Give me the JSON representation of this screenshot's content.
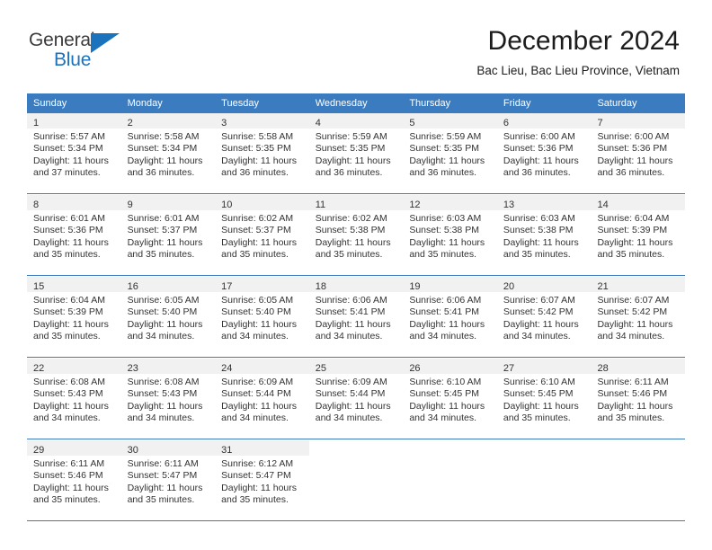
{
  "brand": {
    "name_part1": "General",
    "name_part2": "Blue",
    "accent_color": "#1b72bd"
  },
  "header": {
    "month_title": "December 2024",
    "location": "Bac Lieu, Bac Lieu Province, Vietnam",
    "header_bg_color": "#3b7cc1",
    "daynum_band_color": "#f1f1f1"
  },
  "weekdays": [
    "Sunday",
    "Monday",
    "Tuesday",
    "Wednesday",
    "Thursday",
    "Friday",
    "Saturday"
  ],
  "weeks": [
    [
      {
        "day": "1",
        "lines": [
          "Sunrise: 5:57 AM",
          "Sunset: 5:34 PM",
          "Daylight: 11 hours",
          "and 37 minutes."
        ]
      },
      {
        "day": "2",
        "lines": [
          "Sunrise: 5:58 AM",
          "Sunset: 5:34 PM",
          "Daylight: 11 hours",
          "and 36 minutes."
        ]
      },
      {
        "day": "3",
        "lines": [
          "Sunrise: 5:58 AM",
          "Sunset: 5:35 PM",
          "Daylight: 11 hours",
          "and 36 minutes."
        ]
      },
      {
        "day": "4",
        "lines": [
          "Sunrise: 5:59 AM",
          "Sunset: 5:35 PM",
          "Daylight: 11 hours",
          "and 36 minutes."
        ]
      },
      {
        "day": "5",
        "lines": [
          "Sunrise: 5:59 AM",
          "Sunset: 5:35 PM",
          "Daylight: 11 hours",
          "and 36 minutes."
        ]
      },
      {
        "day": "6",
        "lines": [
          "Sunrise: 6:00 AM",
          "Sunset: 5:36 PM",
          "Daylight: 11 hours",
          "and 36 minutes."
        ]
      },
      {
        "day": "7",
        "lines": [
          "Sunrise: 6:00 AM",
          "Sunset: 5:36 PM",
          "Daylight: 11 hours",
          "and 36 minutes."
        ]
      }
    ],
    [
      {
        "day": "8",
        "lines": [
          "Sunrise: 6:01 AM",
          "Sunset: 5:36 PM",
          "Daylight: 11 hours",
          "and 35 minutes."
        ]
      },
      {
        "day": "9",
        "lines": [
          "Sunrise: 6:01 AM",
          "Sunset: 5:37 PM",
          "Daylight: 11 hours",
          "and 35 minutes."
        ]
      },
      {
        "day": "10",
        "lines": [
          "Sunrise: 6:02 AM",
          "Sunset: 5:37 PM",
          "Daylight: 11 hours",
          "and 35 minutes."
        ]
      },
      {
        "day": "11",
        "lines": [
          "Sunrise: 6:02 AM",
          "Sunset: 5:38 PM",
          "Daylight: 11 hours",
          "and 35 minutes."
        ]
      },
      {
        "day": "12",
        "lines": [
          "Sunrise: 6:03 AM",
          "Sunset: 5:38 PM",
          "Daylight: 11 hours",
          "and 35 minutes."
        ]
      },
      {
        "day": "13",
        "lines": [
          "Sunrise: 6:03 AM",
          "Sunset: 5:38 PM",
          "Daylight: 11 hours",
          "and 35 minutes."
        ]
      },
      {
        "day": "14",
        "lines": [
          "Sunrise: 6:04 AM",
          "Sunset: 5:39 PM",
          "Daylight: 11 hours",
          "and 35 minutes."
        ]
      }
    ],
    [
      {
        "day": "15",
        "lines": [
          "Sunrise: 6:04 AM",
          "Sunset: 5:39 PM",
          "Daylight: 11 hours",
          "and 35 minutes."
        ]
      },
      {
        "day": "16",
        "lines": [
          "Sunrise: 6:05 AM",
          "Sunset: 5:40 PM",
          "Daylight: 11 hours",
          "and 34 minutes."
        ]
      },
      {
        "day": "17",
        "lines": [
          "Sunrise: 6:05 AM",
          "Sunset: 5:40 PM",
          "Daylight: 11 hours",
          "and 34 minutes."
        ]
      },
      {
        "day": "18",
        "lines": [
          "Sunrise: 6:06 AM",
          "Sunset: 5:41 PM",
          "Daylight: 11 hours",
          "and 34 minutes."
        ]
      },
      {
        "day": "19",
        "lines": [
          "Sunrise: 6:06 AM",
          "Sunset: 5:41 PM",
          "Daylight: 11 hours",
          "and 34 minutes."
        ]
      },
      {
        "day": "20",
        "lines": [
          "Sunrise: 6:07 AM",
          "Sunset: 5:42 PM",
          "Daylight: 11 hours",
          "and 34 minutes."
        ]
      },
      {
        "day": "21",
        "lines": [
          "Sunrise: 6:07 AM",
          "Sunset: 5:42 PM",
          "Daylight: 11 hours",
          "and 34 minutes."
        ]
      }
    ],
    [
      {
        "day": "22",
        "lines": [
          "Sunrise: 6:08 AM",
          "Sunset: 5:43 PM",
          "Daylight: 11 hours",
          "and 34 minutes."
        ]
      },
      {
        "day": "23",
        "lines": [
          "Sunrise: 6:08 AM",
          "Sunset: 5:43 PM",
          "Daylight: 11 hours",
          "and 34 minutes."
        ]
      },
      {
        "day": "24",
        "lines": [
          "Sunrise: 6:09 AM",
          "Sunset: 5:44 PM",
          "Daylight: 11 hours",
          "and 34 minutes."
        ]
      },
      {
        "day": "25",
        "lines": [
          "Sunrise: 6:09 AM",
          "Sunset: 5:44 PM",
          "Daylight: 11 hours",
          "and 34 minutes."
        ]
      },
      {
        "day": "26",
        "lines": [
          "Sunrise: 6:10 AM",
          "Sunset: 5:45 PM",
          "Daylight: 11 hours",
          "and 34 minutes."
        ]
      },
      {
        "day": "27",
        "lines": [
          "Sunrise: 6:10 AM",
          "Sunset: 5:45 PM",
          "Daylight: 11 hours",
          "and 35 minutes."
        ]
      },
      {
        "day": "28",
        "lines": [
          "Sunrise: 6:11 AM",
          "Sunset: 5:46 PM",
          "Daylight: 11 hours",
          "and 35 minutes."
        ]
      }
    ],
    [
      {
        "day": "29",
        "lines": [
          "Sunrise: 6:11 AM",
          "Sunset: 5:46 PM",
          "Daylight: 11 hours",
          "and 35 minutes."
        ]
      },
      {
        "day": "30",
        "lines": [
          "Sunrise: 6:11 AM",
          "Sunset: 5:47 PM",
          "Daylight: 11 hours",
          "and 35 minutes."
        ]
      },
      {
        "day": "31",
        "lines": [
          "Sunrise: 6:12 AM",
          "Sunset: 5:47 PM",
          "Daylight: 11 hours",
          "and 35 minutes."
        ]
      },
      {
        "day": "",
        "lines": []
      },
      {
        "day": "",
        "lines": []
      },
      {
        "day": "",
        "lines": []
      },
      {
        "day": "",
        "lines": []
      }
    ]
  ]
}
